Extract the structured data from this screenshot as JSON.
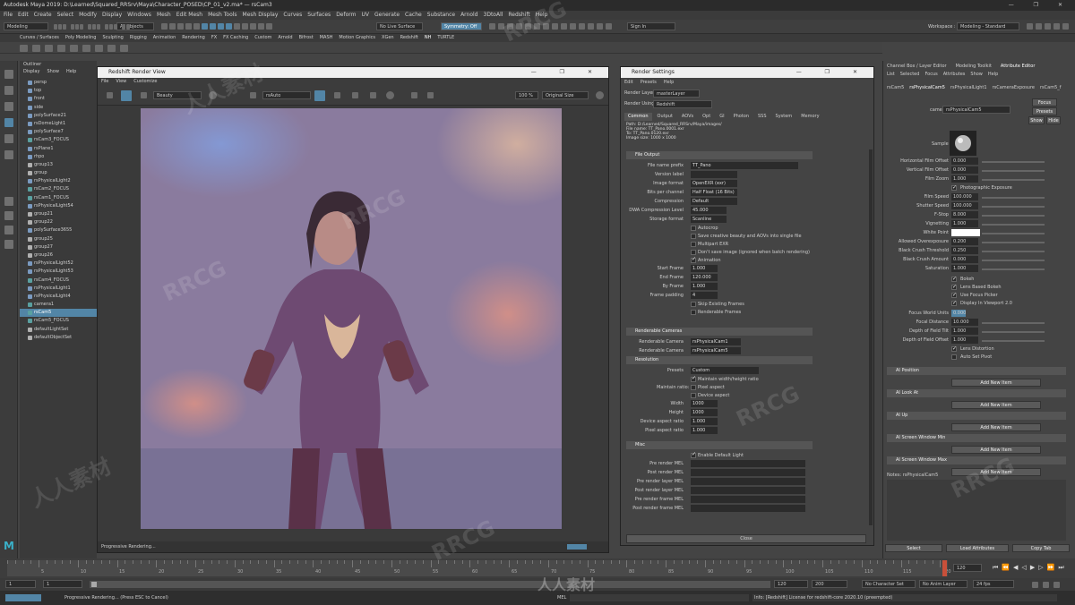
{
  "window": {
    "title": "Autodesk Maya 2019: D:\\Learned\\Squared_RRSrv\\Maya\\Character_POSED\\CP_01_v2.ma* — rsCam3",
    "controls": "— ❐ ✕"
  },
  "menus": [
    "File",
    "Edit",
    "Create",
    "Select",
    "Modify",
    "Display",
    "Windows",
    "Mesh",
    "Edit Mesh",
    "Mesh Tools",
    "Mesh Display",
    "Curves",
    "Surfaces",
    "Deform",
    "UV",
    "Generate",
    "Cache",
    "Substance",
    "Arnold",
    "3DtoAll",
    "Redshift",
    "Help"
  ],
  "status": {
    "mode": "Modeling",
    "objects": "All objects",
    "live": "No Live Surface",
    "symmetry": "Symmetry: Off",
    "sign_in": "Sign In",
    "workspace_label": "Workspace :",
    "workspace": "Modeling - Standard"
  },
  "shelf_tabs": [
    "Curves / Surfaces",
    "Poly Modeling",
    "Sculpting",
    "Rigging",
    "Animation",
    "Rendering",
    "FX",
    "FX Caching",
    "Custom",
    "Arnold",
    "Bifrost",
    "MASH",
    "Motion Graphics",
    "XGen",
    "Redshift",
    "NH",
    "TURTLE"
  ],
  "outliner": {
    "title": "Outliner",
    "menu": [
      "Display",
      "Show",
      "Help"
    ],
    "items": [
      "persp",
      "top",
      "front",
      "side",
      "polySurface21",
      "rsDomeLight1",
      "polySurface7",
      "rsCam3_FOCUS",
      "rsPlane1",
      "rhpo",
      "group13",
      "group",
      "rsPhysicalLight2",
      "rsCam2_FOCUS",
      "rsCam1_FOCUS",
      "rsPhysicalLight54",
      "group21",
      "group22",
      "polySurface3655",
      "group25",
      "group27",
      "group26",
      "rsPhysicalLight52",
      "rsPhysicalLight53",
      "rsCam4_FOCUS",
      "rsPhysicalLight1",
      "rsPhysicalLight4",
      "camera1",
      "rsCam5",
      "rsCam5_FOCUS",
      "defaultLightSet",
      "defaultObjectSet"
    ],
    "selected_index": 28
  },
  "render_view": {
    "title": "Redshift Render View",
    "menu": [
      "File",
      "View",
      "Customize"
    ],
    "aov": "Beauty",
    "camera": "rsAuto",
    "zoom": "100 %",
    "size": "Original Size",
    "status": "Progressive Rendering..."
  },
  "render_settings": {
    "title": "Render Settings",
    "menu": [
      "Edit",
      "Presets",
      "Help"
    ],
    "render_layer_label": "Render Layer",
    "render_layer": "masterLayer",
    "render_using_label": "Render Using",
    "render_using": "Redshift",
    "tabs": [
      "Common",
      "Output",
      "AOVs",
      "Opt",
      "GI",
      "Photon",
      "SSS",
      "System",
      "Memory"
    ],
    "path": "Path: D:/Learned/Squared_RRSrv/Maya/images/",
    "file_name": "File name:  TT_Pano.0001.exr",
    "to": "To:           TT_Pano.0120.exr",
    "image_size": "Image size: 1000 x 1000",
    "file_output": {
      "header": "File Output",
      "rows": [
        {
          "label": "File name prefix",
          "value": "TT_Pano"
        },
        {
          "label": "Version label",
          "value": ""
        },
        {
          "label": "Image format",
          "value": "OpenEXR (exr)"
        },
        {
          "label": "Bits per channel",
          "value": "Half Float (16 Bits)"
        },
        {
          "label": "Compression",
          "value": "Default"
        },
        {
          "label": "DWA Compression Level",
          "value": "45.000"
        },
        {
          "label": "Storage format",
          "value": "Scanline"
        }
      ],
      "checks": [
        {
          "label": "Autocrop",
          "on": false
        },
        {
          "label": "Save creative beauty and AOVs into single file",
          "on": false
        },
        {
          "label": "Multipart EXR",
          "on": false
        },
        {
          "label": "Don't save image (ignored when batch rendering)",
          "on": false
        },
        {
          "label": "Animation",
          "on": true
        }
      ],
      "frames": [
        {
          "label": "Start Frame",
          "value": "1.000"
        },
        {
          "label": "End Frame",
          "value": "120.000"
        },
        {
          "label": "By Frame",
          "value": "1.000"
        },
        {
          "label": "Frame padding",
          "value": "4"
        }
      ],
      "checks2": [
        {
          "label": "Skip Existing Frames",
          "on": false
        },
        {
          "label": "Renderable Frames",
          "on": false
        }
      ]
    },
    "renderable_cameras": {
      "header": "Renderable Cameras",
      "rows": [
        {
          "label": "Renderable Camera",
          "value": "rsPhysicalCam1"
        },
        {
          "label": "Renderable Camera",
          "value": "rsPhysicalCam5"
        }
      ]
    },
    "resolution": {
      "header": "Resolution",
      "presets_label": "Presets",
      "presets": "Custom",
      "maintain": "Maintain width/height ratio",
      "maintain_ratio_label": "Maintain ratio:",
      "pixel_aspect": "Pixel aspect",
      "device_aspect": "Device aspect",
      "rows": [
        {
          "label": "Width",
          "value": "1000"
        },
        {
          "label": "Height",
          "value": "1000"
        },
        {
          "label": "Device aspect ratio",
          "value": "1.000"
        },
        {
          "label": "Pixel aspect ratio",
          "value": "1.000"
        }
      ]
    },
    "misc": {
      "header": "Misc",
      "enable_default_light": "Enable Default Light",
      "mels": [
        "Pre render MEL",
        "Post render MEL",
        "Pre render layer MEL",
        "Post render layer MEL",
        "Pre render frame MEL",
        "Post render frame MEL"
      ]
    },
    "close": "Close"
  },
  "attribute_editor": {
    "tabs": [
      "Channel Box / Layer Editor",
      "Modeling Toolkit",
      "Attribute Editor"
    ],
    "menu": [
      "List",
      "Selected",
      "Focus",
      "Attributes",
      "Show",
      "Help"
    ],
    "node_tabs": [
      "rsCam5",
      "rsPhysicalCam5",
      "rsPhysicalLight1",
      "rsCameraExposure",
      "rsCam5_f"
    ],
    "node_label": "camera:",
    "node_value": "rsPhysicalCam5",
    "focus": "Focus",
    "presets": "Presets",
    "show": "Show",
    "hide": "Hide",
    "sample": "Sample",
    "rows": [
      {
        "label": "Horizontal Film Offset",
        "value": "0.000"
      },
      {
        "label": "Vertical Film Offset",
        "value": "0.000"
      },
      {
        "label": "Film Zoom",
        "value": "1.000"
      },
      {
        "label": "",
        "value": "Photographic Exposure"
      },
      {
        "label": "Film Speed",
        "value": "100.000"
      },
      {
        "label": "Shutter Speed",
        "value": "100.000"
      },
      {
        "label": "F-Stop",
        "value": "8.000"
      },
      {
        "label": "Vignetting",
        "value": "1.000"
      },
      {
        "label": "White Point",
        "value": ""
      },
      {
        "label": "Allowed Overexposure",
        "value": "0.200"
      },
      {
        "label": "Black Crush Threshold",
        "value": "0.250"
      },
      {
        "label": "Black Crush Amount",
        "value": "0.000"
      },
      {
        "label": "Saturation",
        "value": "1.000"
      }
    ],
    "checks": [
      "Bokeh",
      "Lens Based Bokeh",
      "Use Focus Picker",
      "Display In Viewport 2.0"
    ],
    "rows2": [
      {
        "label": "Focus World Units",
        "value": "0.000"
      },
      {
        "label": "Focal Distance",
        "value": "10.000"
      },
      {
        "label": "Depth of Field Tilt",
        "value": "1.000"
      },
      {
        "label": "Depth of Field Offset",
        "value": "1.000"
      }
    ],
    "checks2": [
      "Lens Distortion",
      "Auto Set Pivot"
    ],
    "sections": [
      {
        "title": "AI Position",
        "button": "Add New Item"
      },
      {
        "title": "AI Look At",
        "button": "Add New Item"
      },
      {
        "title": "AI Up",
        "button": "Add New Item"
      },
      {
        "title": "AI Screen Window Min",
        "button": "Add New Item"
      },
      {
        "title": "AI Screen Window Max",
        "button": "Add New Item"
      }
    ],
    "notes": "Notes: rsPhysicalCam5",
    "select": "Select",
    "load": "Load Attributes",
    "copy": "Copy Tab"
  },
  "timeline": {
    "ticks": [
      "5",
      "10",
      "15",
      "20",
      "25",
      "30",
      "35",
      "40",
      "45",
      "50",
      "55",
      "60",
      "65",
      "70",
      "75",
      "80",
      "85",
      "90",
      "95",
      "100",
      "105",
      "110",
      "115",
      "120"
    ],
    "current": "120"
  },
  "range": {
    "start": "1",
    "start2": "1",
    "end": "120",
    "end2": "120",
    "end3": "200",
    "character_set": "No Character Set",
    "anim_layer": "No Anim Layer",
    "fps": "24 fps"
  },
  "help": {
    "progress": "Progressive Rendering... (Press ESC to Cancel)",
    "mel": "MEL",
    "message": "Info: [Redshift] License for redshift-core 2020.10 (preempted)"
  },
  "watermarks": [
    "RRCG",
    "人人素材"
  ]
}
